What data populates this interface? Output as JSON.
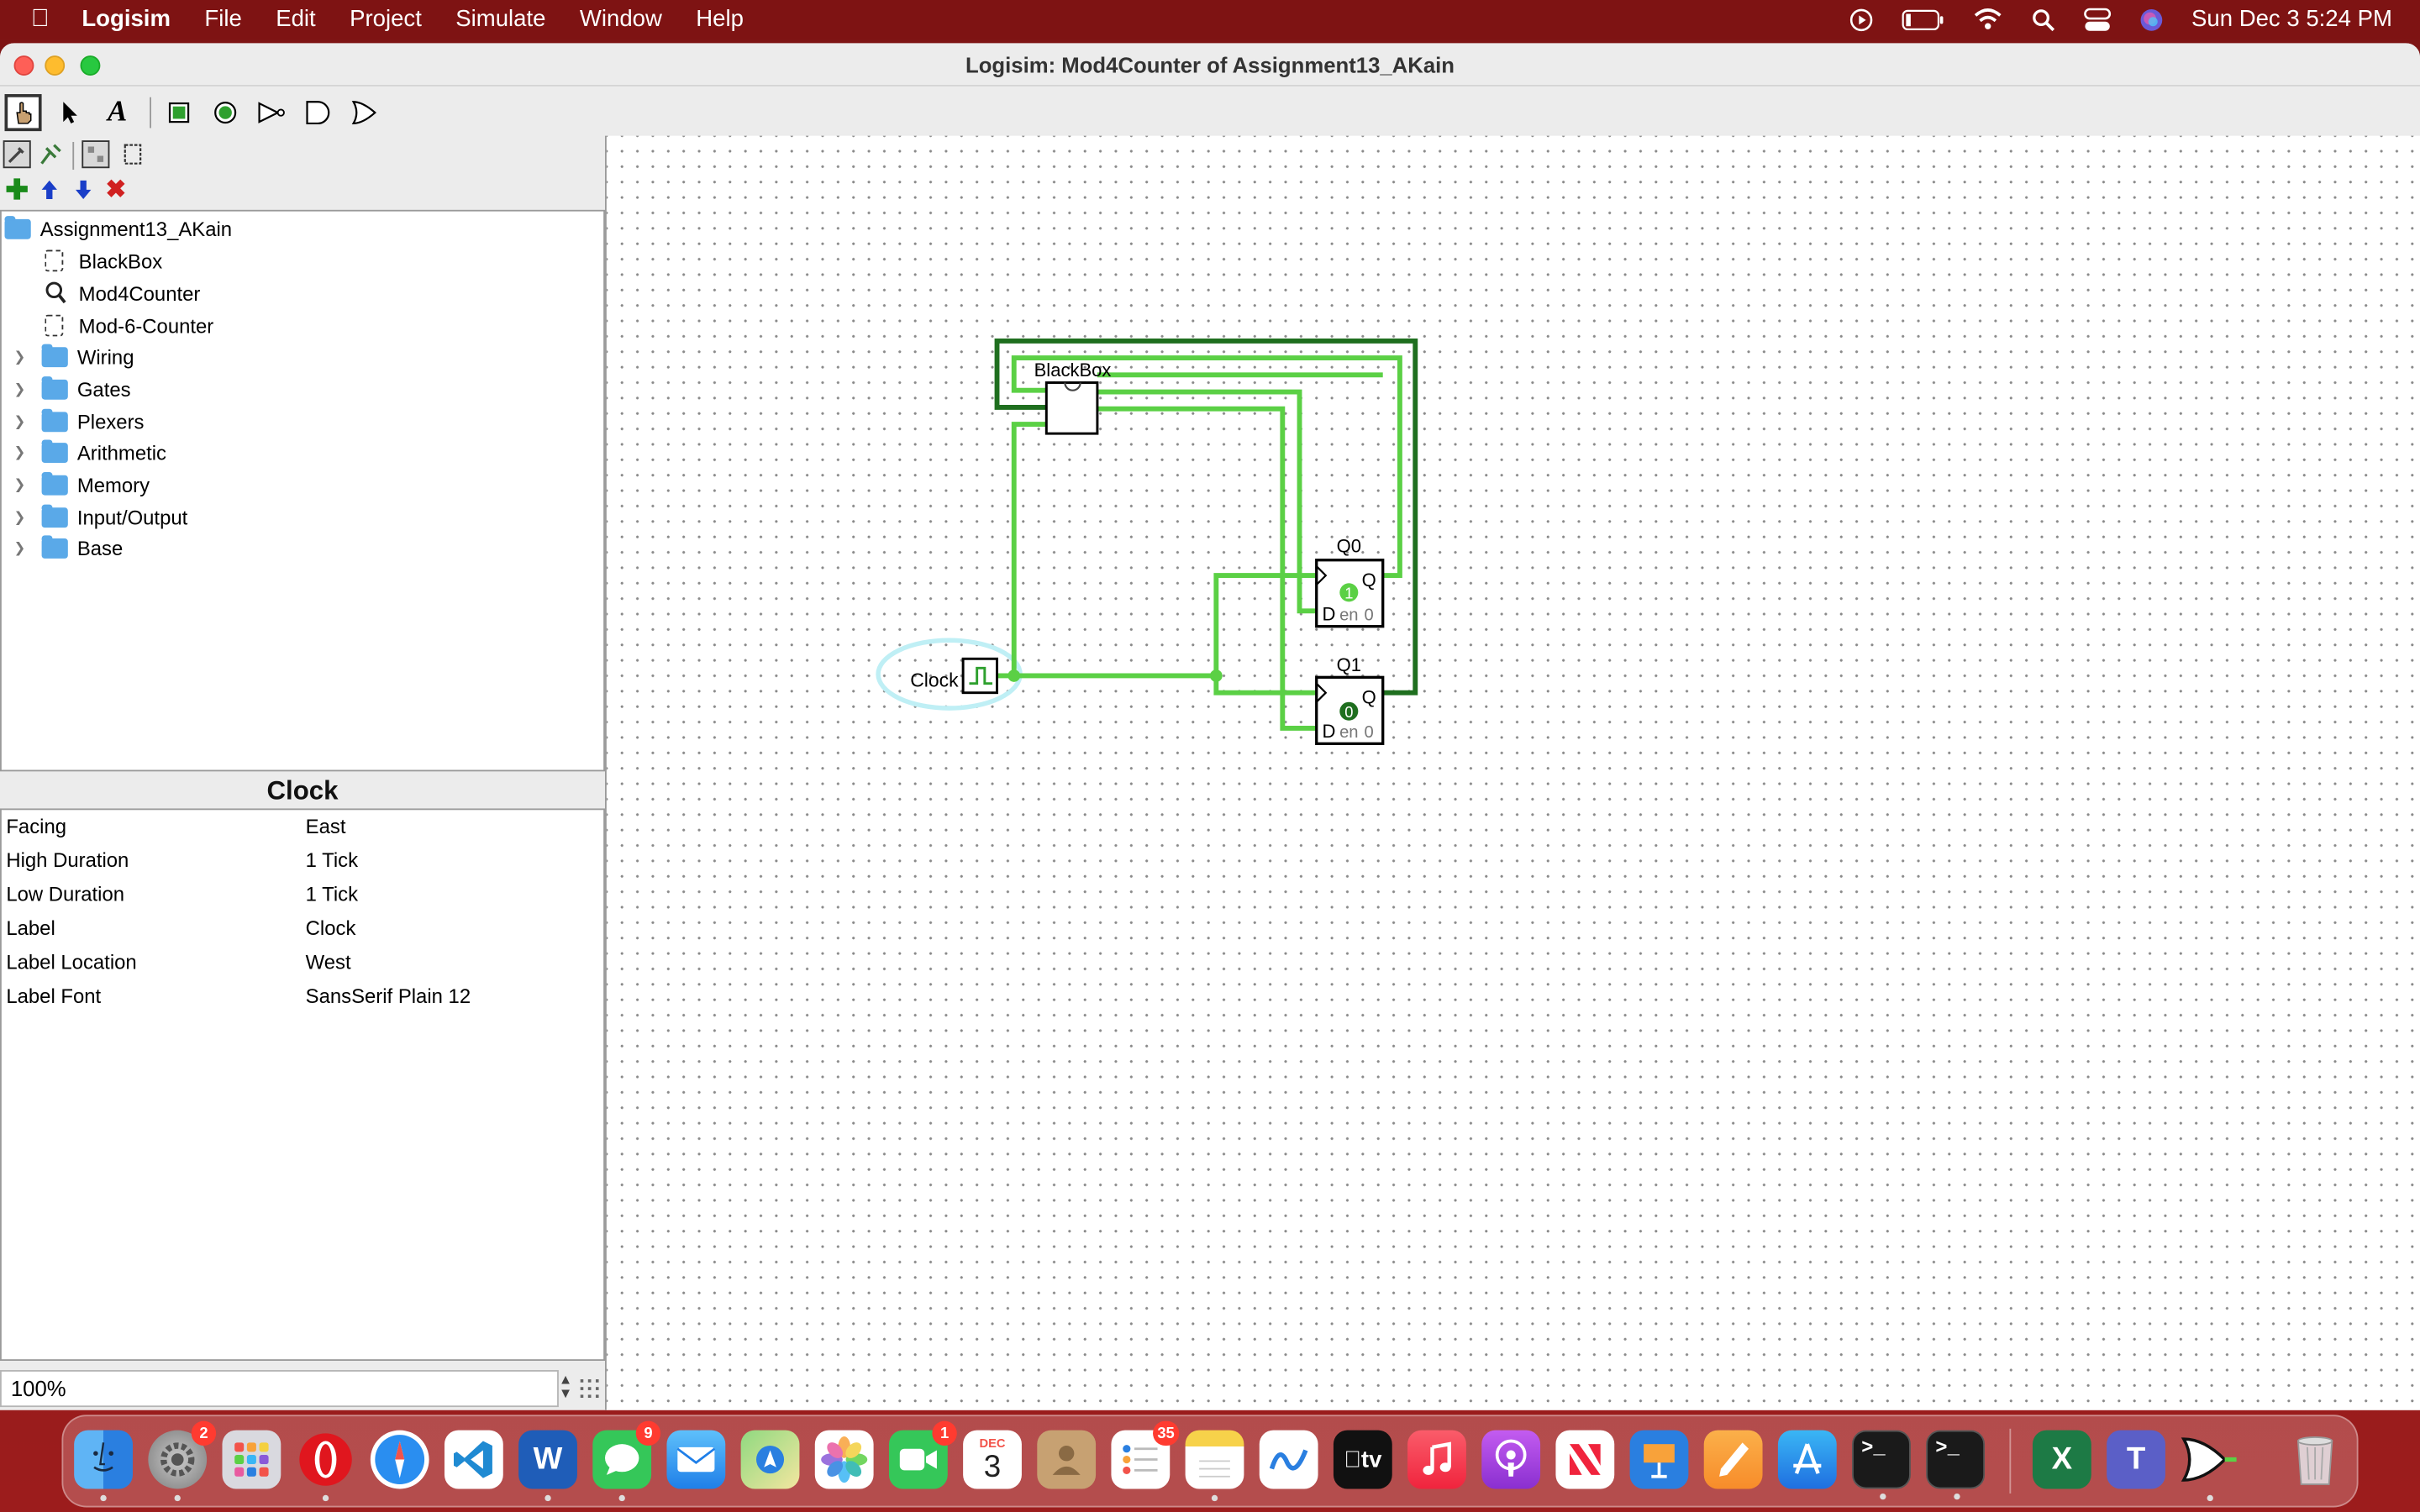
{
  "menubar": {
    "app_name": "Logisim",
    "items": [
      "File",
      "Edit",
      "Project",
      "Simulate",
      "Window",
      "Help"
    ],
    "date_time": "Sun Dec 3  5:24 PM"
  },
  "window": {
    "title": "Logisim: Mod4Counter of Assignment13_AKain"
  },
  "project_tree": {
    "root": "Assignment13_AKain",
    "circuits": [
      "BlackBox",
      "Mod4Counter",
      "Mod-6-Counter"
    ],
    "libraries": [
      "Wiring",
      "Gates",
      "Plexers",
      "Arithmetic",
      "Memory",
      "Input/Output",
      "Base"
    ]
  },
  "attributes": {
    "title": "Clock",
    "rows": [
      {
        "key": "Facing",
        "value": "East"
      },
      {
        "key": "High Duration",
        "value": "1 Tick"
      },
      {
        "key": "Low Duration",
        "value": "1 Tick"
      },
      {
        "key": "Label",
        "value": "Clock"
      },
      {
        "key": "Label Location",
        "value": "West"
      },
      {
        "key": "Label Font",
        "value": "SansSerif Plain 12"
      }
    ]
  },
  "zoom": "100%",
  "circuit": {
    "subcircuit_label": "BlackBox",
    "clock_label": "Clock",
    "ff0": {
      "label": "Q0",
      "out": "Q",
      "d": "D",
      "en": "en",
      "state": "0",
      "value": "1"
    },
    "ff1": {
      "label": "Q1",
      "out": "Q",
      "d": "D",
      "en": "en",
      "state": "0",
      "value": "0"
    }
  },
  "dock": {
    "apps": [
      {
        "name": "Finder",
        "badge": ""
      },
      {
        "name": "System Settings",
        "badge": "2"
      },
      {
        "name": "Launchpad",
        "badge": ""
      },
      {
        "name": "Opera",
        "badge": ""
      },
      {
        "name": "Safari",
        "badge": ""
      },
      {
        "name": "VS Code",
        "badge": ""
      },
      {
        "name": "Word",
        "badge": ""
      },
      {
        "name": "Messages",
        "badge": "9"
      },
      {
        "name": "Mail",
        "badge": ""
      },
      {
        "name": "Maps",
        "badge": ""
      },
      {
        "name": "Photos",
        "badge": ""
      },
      {
        "name": "FaceTime",
        "badge": "1"
      },
      {
        "name": "Calendar",
        "badge": ""
      },
      {
        "name": "Contacts",
        "badge": ""
      },
      {
        "name": "Reminders",
        "badge": "35"
      },
      {
        "name": "Notes",
        "badge": ""
      },
      {
        "name": "Freeform",
        "badge": ""
      },
      {
        "name": "TV",
        "badge": ""
      },
      {
        "name": "Music",
        "badge": ""
      },
      {
        "name": "Podcasts",
        "badge": ""
      },
      {
        "name": "News",
        "badge": ""
      },
      {
        "name": "Keynote",
        "badge": ""
      },
      {
        "name": "Pages",
        "badge": ""
      },
      {
        "name": "App Store",
        "badge": ""
      },
      {
        "name": "Terminal",
        "badge": ""
      },
      {
        "name": "Terminal 2",
        "badge": ""
      },
      {
        "name": "Excel",
        "badge": ""
      },
      {
        "name": "Teams",
        "badge": ""
      },
      {
        "name": "Logisim",
        "badge": ""
      },
      {
        "name": "Trash",
        "badge": ""
      }
    ],
    "calendar_month": "DEC",
    "calendar_day": "3",
    "tv_label": "tv"
  }
}
